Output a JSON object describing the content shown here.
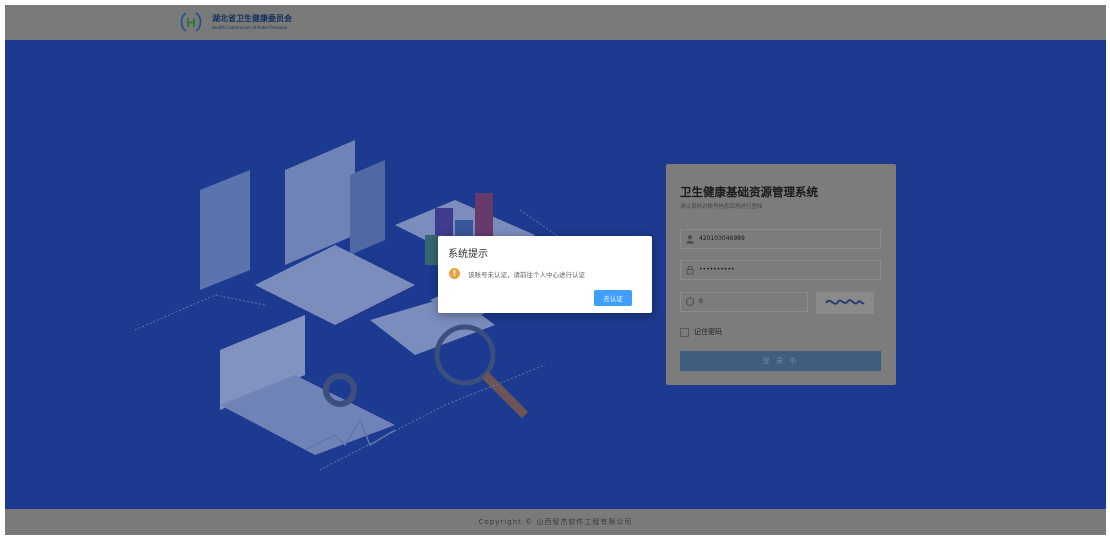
{
  "header": {
    "logo_cn": "湖北省卫生健康委员会",
    "logo_en": "Health Commission of Hubei Province"
  },
  "login": {
    "title": "卫生健康基础资源管理系统",
    "subtitle": "请认真核对账号信息后再进行登陆",
    "username": "420103046989",
    "password": "••••••••••",
    "captcha_value": "0",
    "remember_label": "记住密码",
    "submit_label": "登 录 中"
  },
  "dialog": {
    "title": "系统提示",
    "message": "该账号未认证，请前往个人中心进行认证",
    "button": "去认证"
  },
  "footer": {
    "copyright": "Copyright © 山西智杰软件工程有限公司"
  },
  "colors": {
    "main_bg": "#1c3a8f",
    "dialog_button": "#409eff",
    "warning": "#e6a23c"
  },
  "icons": [
    "user-icon",
    "lock-icon",
    "shield-icon",
    "warning-icon",
    "logo-emblem-icon"
  ]
}
